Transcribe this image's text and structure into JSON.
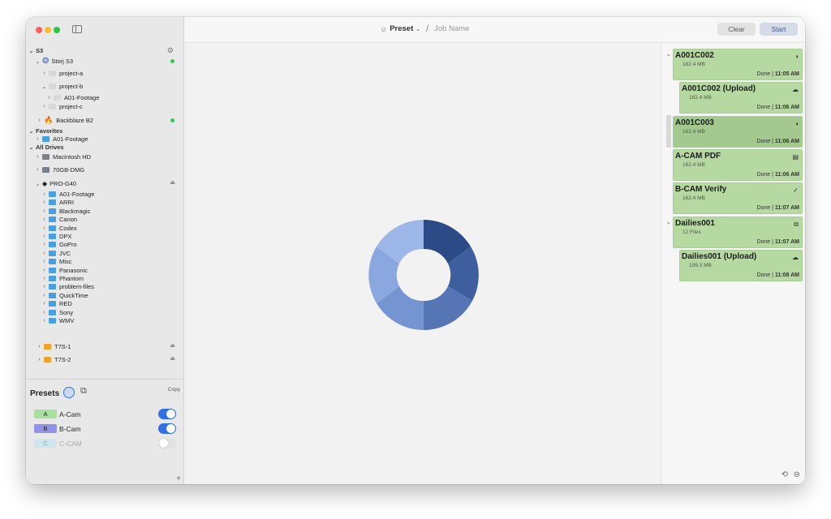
{
  "window": {
    "traffic_colors": {
      "close": "#ff5f57",
      "minimize": "#febc2e",
      "zoom": "#28c840"
    }
  },
  "sidebar": {
    "s3_section": "S3",
    "storj": {
      "label": "Storj S3",
      "children": [
        {
          "label": "project-a"
        },
        {
          "label": "project-b",
          "children": [
            {
              "label": "A01-Footage"
            }
          ]
        },
        {
          "label": "project-c"
        }
      ]
    },
    "backblaze": {
      "label": "Backblaze B2"
    },
    "favorites_section": "Favorites",
    "favorites": [
      {
        "label": "A01-Footage"
      }
    ],
    "drives_section": "All Drives",
    "drives": [
      {
        "label": "Macintosh HD"
      },
      {
        "label": "70GB-DMG"
      }
    ],
    "pro_g40": {
      "label": "PRO-G40",
      "folders": [
        "A01-Footage",
        "ARRI",
        "Blackmagic",
        "Canon",
        "Codex",
        "DPX",
        "GoPro",
        "JVC",
        "Misc",
        "Panasonic",
        "Phantom",
        "problem-files",
        "QuickTime",
        "RED",
        "Sony",
        "WMV"
      ]
    },
    "t7s": [
      {
        "label": "T7S-1"
      },
      {
        "label": "T7S-2"
      }
    ]
  },
  "presets": {
    "title": "Presets",
    "copy_label": "Copy",
    "items": [
      {
        "tag": "A",
        "label": "A-Cam",
        "enabled": true,
        "color": "#a8e0a0"
      },
      {
        "tag": "B",
        "label": "B-Cam",
        "enabled": true,
        "color": "#8f93e8"
      },
      {
        "tag": "C",
        "label": "C-CAM",
        "enabled": false,
        "color": "#cfe6ee"
      }
    ],
    "add_label": "+"
  },
  "toolbar": {
    "preset_label": "Preset",
    "separator": "/",
    "job_name_placeholder": "Job Name",
    "clear_label": "Clear",
    "start_label": "Start"
  },
  "queue": {
    "jobs": [
      {
        "title": "A001C002",
        "size": "162.4 MB",
        "status": "Done",
        "time": "11:05 AM",
        "icon": "circle-progress-icon"
      },
      {
        "title": "A001C002 (Upload)",
        "size": "162.4 MB",
        "status": "Done",
        "time": "11:06 AM",
        "icon": "cloud-upload-icon"
      },
      {
        "title": "A001C003",
        "size": "162.4 MB",
        "status": "Done",
        "time": "11:06 AM",
        "icon": "circle-progress-icon"
      },
      {
        "title": "A-CAM PDF",
        "size": "162.4 MB",
        "status": "Done",
        "time": "11:06 AM",
        "icon": "document-icon"
      },
      {
        "title": "B-CAM Verify",
        "size": "162.4 MB",
        "status": "Done",
        "time": "11:07 AM",
        "icon": "check-circle-icon"
      },
      {
        "title": "Dailies001",
        "size": "12 Files",
        "status": "Done",
        "time": "11:07 AM",
        "icon": "transcode-icon"
      },
      {
        "title": "Dailies001 (Upload)",
        "size": "199.3 MB",
        "status": "Done",
        "time": "11:08 AM",
        "icon": "cloud-upload-icon"
      }
    ],
    "selected_index": 2
  },
  "colors": {
    "accent": "#2f6fe8",
    "job_green": "#b6d9a2",
    "job_selected": "#a3c98f",
    "logo_blue": "#5b7cc4"
  }
}
